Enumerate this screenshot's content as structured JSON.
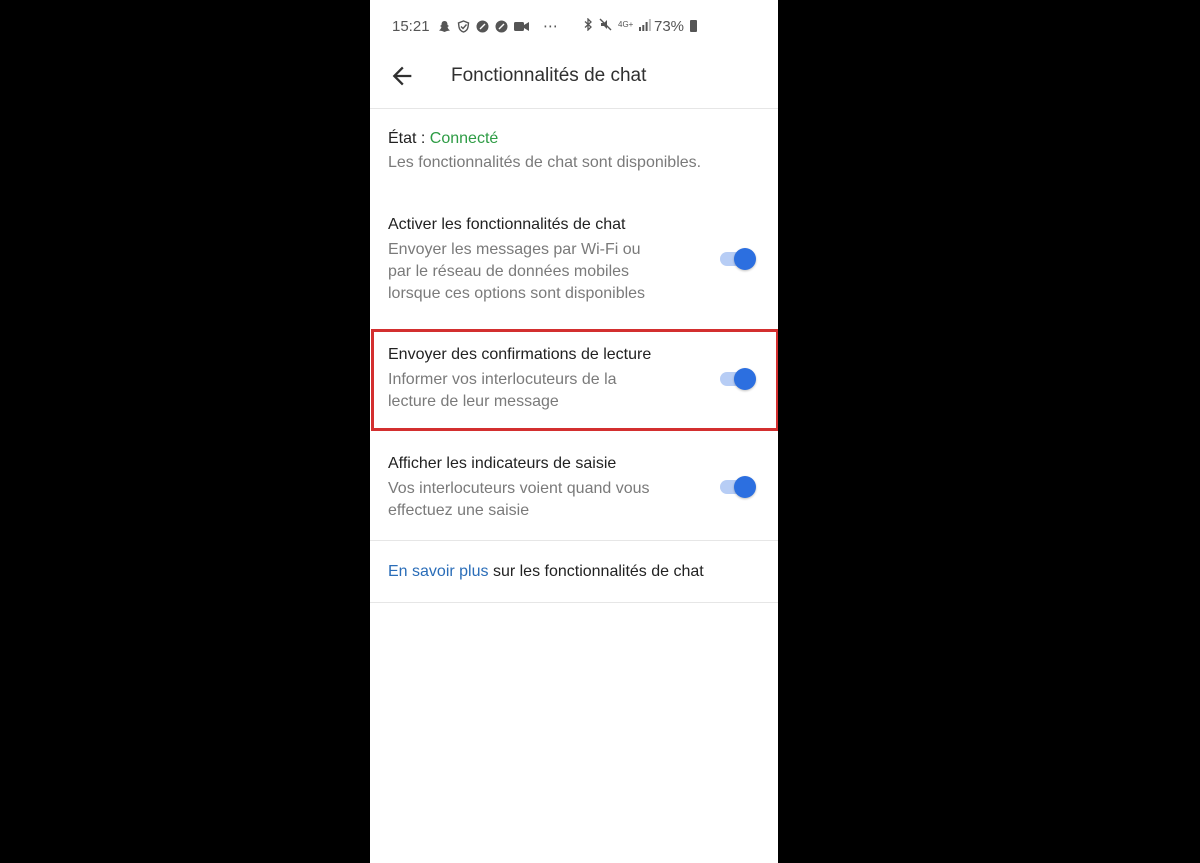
{
  "status_bar": {
    "time": "15:21",
    "notif_dots": "⋯",
    "battery": "73%",
    "signal_label": "4G+"
  },
  "app_bar": {
    "title": "Fonctionnalités de chat"
  },
  "state": {
    "label": "État : ",
    "value": "Connecté",
    "description": "Les fonctionnalités de chat sont disponibles.",
    "value_color": "#2e9c45"
  },
  "settings": [
    {
      "title": "Activer les fonctionnalités de chat",
      "description_lines": [
        "Envoyer les messages par Wi-Fi ou",
        "par le réseau de données mobiles",
        "lorsque ces options sont disponibles"
      ],
      "enabled": true
    },
    {
      "title": "Envoyer des confirmations de lecture",
      "description_lines": [
        "Informer vos interlocuteurs de la",
        "lecture de leur message"
      ],
      "enabled": true,
      "highlighted": true
    },
    {
      "title": "Afficher les indicateurs de saisie",
      "description_lines": [
        "Vos interlocuteurs voient quand vous",
        "effectuez une saisie"
      ],
      "enabled": true
    }
  ],
  "learn_more": {
    "link": "En savoir plus",
    "rest": " sur les fonctionnalités de chat"
  },
  "colors": {
    "accent": "#2c6fe0",
    "highlight": "#d32f2f",
    "link": "#2a6db8"
  }
}
